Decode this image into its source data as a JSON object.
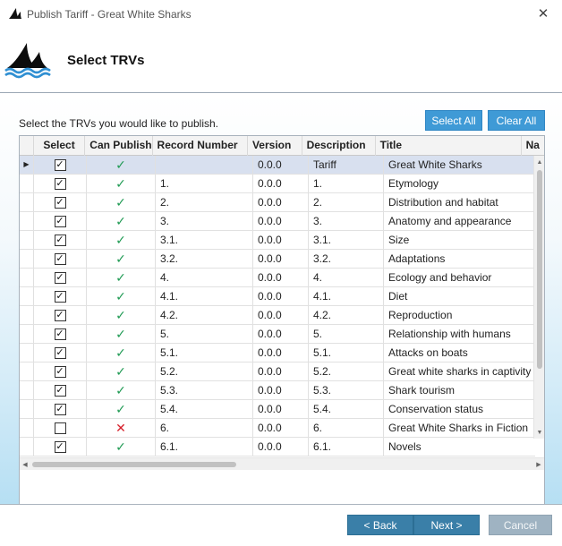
{
  "window": {
    "title": "Publish Tariff - Great White Sharks",
    "close_glyph": "✕"
  },
  "header": {
    "title": "Select TRVs",
    "logo_icon": "shark-fin-icon"
  },
  "instructions": "Select the TRVs you would like to publish.",
  "buttons": {
    "select_all": "Select All",
    "clear_all": "Clear All",
    "back": "< Back",
    "next": "Next >",
    "cancel": "Cancel"
  },
  "colors": {
    "accent": "#3f9ad6",
    "nav_button": "#3a7fa8",
    "check_green": "#1f9a53",
    "cross_red": "#d6202b",
    "selected_row": "#d8e0ef"
  },
  "grid": {
    "columns": [
      "Select",
      "Can Publish?",
      "Record Number",
      "Version",
      "Description",
      "Title",
      "Na"
    ],
    "rows": [
      {
        "selected": true,
        "can_publish": true,
        "record": "",
        "version": "0.0.0",
        "description": "Tariff",
        "title": "Great White Sharks"
      },
      {
        "selected": true,
        "can_publish": true,
        "record": "1.",
        "version": "0.0.0",
        "description": "1.",
        "title": "Etymology"
      },
      {
        "selected": true,
        "can_publish": true,
        "record": "2.",
        "version": "0.0.0",
        "description": "2.",
        "title": "Distribution and habitat"
      },
      {
        "selected": true,
        "can_publish": true,
        "record": "3.",
        "version": "0.0.0",
        "description": "3.",
        "title": "Anatomy and appearance"
      },
      {
        "selected": true,
        "can_publish": true,
        "record": "3.1.",
        "version": "0.0.0",
        "description": "3.1.",
        "title": "Size"
      },
      {
        "selected": true,
        "can_publish": true,
        "record": "3.2.",
        "version": "0.0.0",
        "description": "3.2.",
        "title": "Adaptations"
      },
      {
        "selected": true,
        "can_publish": true,
        "record": "4.",
        "version": "0.0.0",
        "description": "4.",
        "title": "Ecology and behavior"
      },
      {
        "selected": true,
        "can_publish": true,
        "record": "4.1.",
        "version": "0.0.0",
        "description": "4.1.",
        "title": "Diet"
      },
      {
        "selected": true,
        "can_publish": true,
        "record": "4.2.",
        "version": "0.0.0",
        "description": "4.2.",
        "title": "Reproduction"
      },
      {
        "selected": true,
        "can_publish": true,
        "record": "5.",
        "version": "0.0.0",
        "description": "5.",
        "title": "Relationship with humans"
      },
      {
        "selected": true,
        "can_publish": true,
        "record": "5.1.",
        "version": "0.0.0",
        "description": "5.1.",
        "title": "Attacks on boats"
      },
      {
        "selected": true,
        "can_publish": true,
        "record": "5.2.",
        "version": "0.0.0",
        "description": "5.2.",
        "title": "Great white sharks in captivity"
      },
      {
        "selected": true,
        "can_publish": true,
        "record": "5.3.",
        "version": "0.0.0",
        "description": "5.3.",
        "title": "Shark tourism"
      },
      {
        "selected": true,
        "can_publish": true,
        "record": "5.4.",
        "version": "0.0.0",
        "description": "5.4.",
        "title": "Conservation status"
      },
      {
        "selected": false,
        "can_publish": false,
        "record": "6.",
        "version": "0.0.0",
        "description": "6.",
        "title": "Great White Sharks in Fiction"
      },
      {
        "selected": true,
        "can_publish": true,
        "record": "6.1.",
        "version": "0.0.0",
        "description": "6.1.",
        "title": "Novels"
      }
    ]
  }
}
